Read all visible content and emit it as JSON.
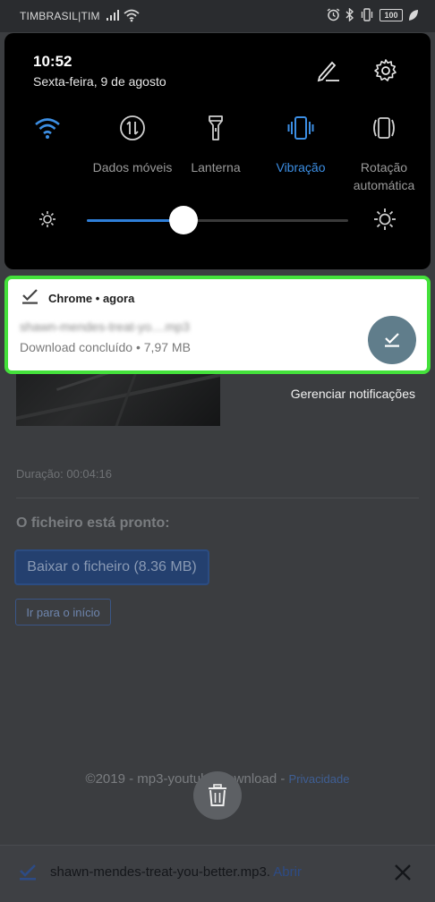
{
  "status_bar": {
    "carrier": "TIMBRASIL|TIM",
    "battery": "100"
  },
  "quick_settings": {
    "time": "10:52",
    "date": "Sexta-feira, 9 de agosto",
    "tiles": [
      {
        "label": "",
        "icon": "wifi-icon",
        "active": true
      },
      {
        "label": "Dados móveis",
        "icon": "mobile-data-icon",
        "active": false
      },
      {
        "label": "Lanterna",
        "icon": "flashlight-icon",
        "active": false
      },
      {
        "label": "Vibração",
        "icon": "vibration-icon",
        "active": true
      },
      {
        "label": "Rotação automática",
        "icon": "auto-rotate-icon",
        "active": false
      }
    ],
    "brightness_fraction": 0.37,
    "accent_color": "#3c8ee3"
  },
  "notification": {
    "app": "Chrome",
    "separator": "•",
    "time": "agora",
    "title": "shawn-mendes-treat-yo....mp3",
    "subtitle": "Download concluído • 7,97 MB",
    "highlight_color": "#44e13b"
  },
  "manage_notifications": "Gerenciar notificações",
  "web_page": {
    "duration": "Duração: 00:04:16",
    "ready_title": "O ficheiro está pronto:",
    "download_button": "Baixar o ficheiro (8.36 MB)",
    "home_button": "Ir para o início",
    "footer": "©2019 - mp3-youtube.download -",
    "privacy_link": "Privacidade"
  },
  "download_bar": {
    "filename": "shawn-mendes-treat-you-better.mp3.",
    "open_link": "Abrir"
  }
}
